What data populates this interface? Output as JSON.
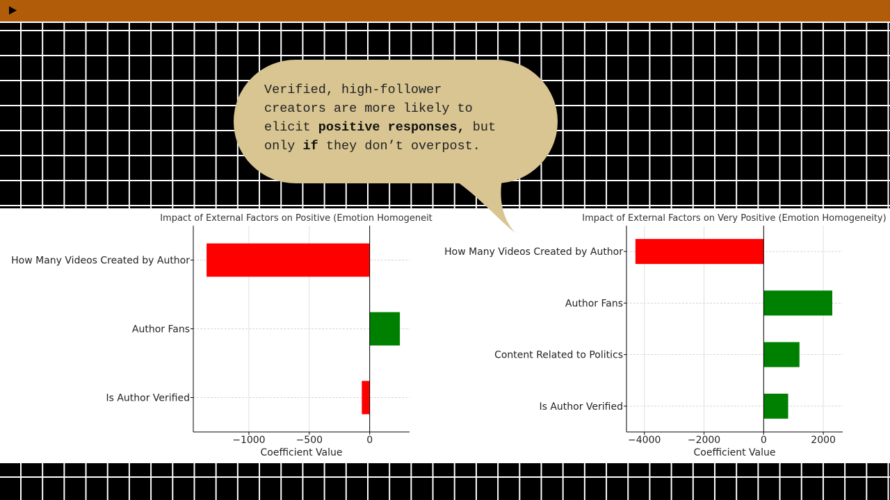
{
  "controls": {
    "play_icon": "play-icon"
  },
  "callout": {
    "line1": "Verified, high-follower",
    "line2": "creators are more likely to",
    "line3_pre": "elicit ",
    "line3_bold": "positive responses,",
    "line3_post": " but",
    "line4_pre": "only ",
    "line4_bold": "if",
    "line4_post": " they don’t overpost."
  },
  "colors": {
    "topbar": "#b05c08",
    "bubble": "#d8c592",
    "negative": "#ff0000",
    "positive": "#008000"
  },
  "chart_data": [
    {
      "type": "bar",
      "orientation": "horizontal",
      "title": "Impact of External Factors on Positive (Emotion Homogeneit",
      "xlabel": "Coefficient Value",
      "categories": [
        "How Many Videos Created by Author",
        "Author Fans",
        "Is Author Verified"
      ],
      "values": [
        -1350,
        250,
        -65
      ],
      "xlim": [
        -1460,
        330
      ],
      "xticks": [
        -1000,
        -500,
        0
      ],
      "xtick_labels": [
        "−1000",
        "−500",
        "0"
      ],
      "grid": true
    },
    {
      "type": "bar",
      "orientation": "horizontal",
      "title": "Impact of External Factors on Very Positive (Emotion Homogeneity)",
      "xlabel": "Coefficient Value",
      "categories": [
        "How Many Videos Created by Author",
        "Author Fans",
        "Content Related to Politics",
        "Is Author Verified"
      ],
      "values": [
        -4300,
        2300,
        1200,
        820
      ],
      "xlim": [
        -4600,
        2650
      ],
      "xticks": [
        -4000,
        -2000,
        0,
        2000
      ],
      "xtick_labels": [
        "−4000",
        "−2000",
        "0",
        "2000"
      ],
      "grid": true
    }
  ]
}
